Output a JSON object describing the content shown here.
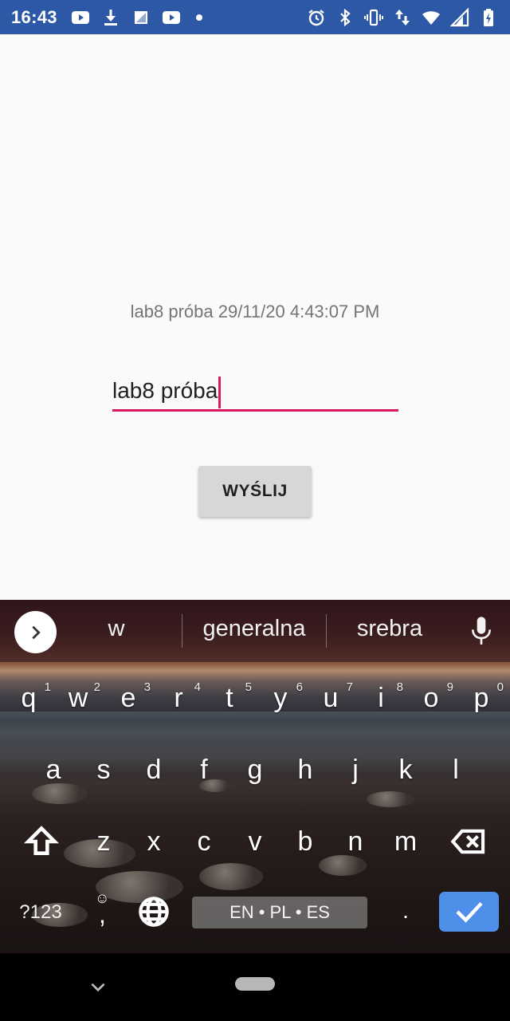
{
  "status_bar": {
    "time": "16:43",
    "left_icons": [
      "youtube-icon",
      "download-icon",
      "sim-icon",
      "youtube-icon"
    ],
    "right_icons": [
      "alarm-icon",
      "bluetooth-icon",
      "vibrate-icon",
      "data-arrows-icon",
      "wifi-icon",
      "signal-icon",
      "battery-icon"
    ],
    "background": "#2c58a6"
  },
  "app": {
    "result_text": "lab8 próba 29/11/20 4:43:07 PM",
    "input_value": "lab8 próba",
    "send_button_label": "WYŚLIJ",
    "accent_color": "#d81b60"
  },
  "keyboard": {
    "suggestions": [
      "w",
      "generalna",
      "srebra"
    ],
    "row1": [
      {
        "key": "q",
        "hint": "1"
      },
      {
        "key": "w",
        "hint": "2"
      },
      {
        "key": "e",
        "hint": "3"
      },
      {
        "key": "r",
        "hint": "4"
      },
      {
        "key": "t",
        "hint": "5"
      },
      {
        "key": "y",
        "hint": "6"
      },
      {
        "key": "u",
        "hint": "7"
      },
      {
        "key": "i",
        "hint": "8"
      },
      {
        "key": "o",
        "hint": "9"
      },
      {
        "key": "p",
        "hint": "0"
      }
    ],
    "row2": [
      "a",
      "s",
      "d",
      "f",
      "g",
      "h",
      "j",
      "k",
      "l"
    ],
    "row3": [
      "z",
      "x",
      "c",
      "v",
      "b",
      "n",
      "m"
    ],
    "symbols_label": "?123",
    "comma_label": ",",
    "space_label": "EN • PL • ES",
    "period_label": ".",
    "enter_color": "#4e8fe9"
  }
}
